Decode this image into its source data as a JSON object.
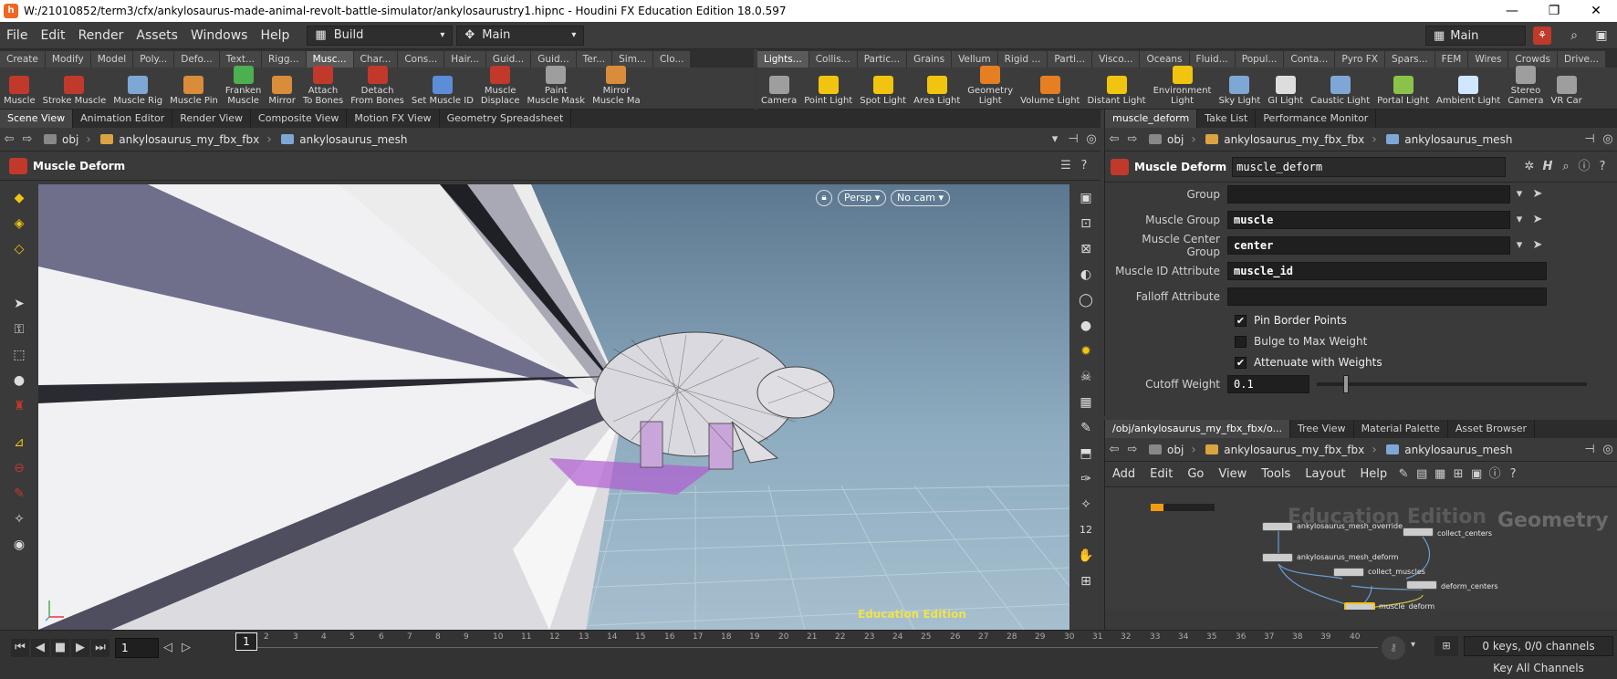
{
  "window": {
    "title": "W:/21010852/term3/cfx/ankylosaurus-made-animal-revolt-battle-simulator/ankylosaurustry1.hipnc - Houdini FX Education Edition 18.0.597",
    "controls": [
      "—",
      "❐",
      "✕"
    ]
  },
  "menubar": {
    "items": [
      "File",
      "Edit",
      "Render",
      "Assets",
      "Windows",
      "Help"
    ],
    "desktop": "Build",
    "network": "Main",
    "right_desktop": "Main"
  },
  "shelf_left": {
    "tabs": [
      "Create",
      "Modify",
      "Model",
      "Poly...",
      "Defo...",
      "Text...",
      "Rigg...",
      "Musc...",
      "Char...",
      "Cons...",
      "Hair...",
      "Guid...",
      "Guid...",
      "Ter...",
      "Sim...",
      "Clo..."
    ],
    "active_tab": 7,
    "tools": [
      {
        "label": "Muscle",
        "color": "#c0392b"
      },
      {
        "label": "Stroke Muscle",
        "color": "#c0392b"
      },
      {
        "label": "Muscle Rig",
        "color": "#7fa7d6"
      },
      {
        "label": "Muscle Pin",
        "color": "#d98c3a"
      },
      {
        "label": "Franken\nMuscle",
        "color": "#4caf50"
      },
      {
        "label": "Mirror",
        "color": "#d98c3a"
      },
      {
        "label": "Attach\nTo Bones",
        "color": "#c0392b"
      },
      {
        "label": "Detach\nFrom Bones",
        "color": "#c0392b"
      },
      {
        "label": "Set Muscle ID",
        "color": "#5b8ed6"
      },
      {
        "label": "Muscle\nDisplace",
        "color": "#c0392b"
      },
      {
        "label": "Paint\nMuscle Mask",
        "color": "#9e9e9e"
      },
      {
        "label": "Mirror\nMuscle Ma",
        "color": "#d98c3a"
      }
    ]
  },
  "shelf_right": {
    "tabs": [
      "Lights...",
      "Collis...",
      "Partic...",
      "Grains",
      "Vellum",
      "Rigid ...",
      "Parti...",
      "Visco...",
      "Oceans",
      "Fluid...",
      "Popul...",
      "Conta...",
      "Pyro FX",
      "Spars...",
      "FEM",
      "Wires",
      "Crowds",
      "Drive..."
    ],
    "active_tab": 0,
    "tools": [
      {
        "label": "Camera",
        "color": "#9e9e9e"
      },
      {
        "label": "Point Light",
        "color": "#f1c40f"
      },
      {
        "label": "Spot Light",
        "color": "#f1c40f"
      },
      {
        "label": "Area Light",
        "color": "#f1c40f"
      },
      {
        "label": "Geometry\nLight",
        "color": "#e67e22"
      },
      {
        "label": "Volume Light",
        "color": "#e67e22"
      },
      {
        "label": "Distant Light",
        "color": "#f1c40f"
      },
      {
        "label": "Environment\nLight",
        "color": "#f1c40f"
      },
      {
        "label": "Sky Light",
        "color": "#7fa7d6"
      },
      {
        "label": "GI Light",
        "color": "#dddddd"
      },
      {
        "label": "Caustic Light",
        "color": "#7fa7d6"
      },
      {
        "label": "Portal Light",
        "color": "#8bc34a"
      },
      {
        "label": "Ambient Light",
        "color": "#cfe8ff"
      },
      {
        "label": "Stereo\nCamera",
        "color": "#9e9e9e"
      },
      {
        "label": "VR Car",
        "color": "#9e9e9e"
      }
    ]
  },
  "viewer": {
    "tabs": [
      "Scene View",
      "Animation Editor",
      "Render View",
      "Composite View",
      "Motion FX View",
      "Geometry Spreadsheet"
    ],
    "active_tab": 0,
    "path": [
      "obj",
      "ankylosaurus_my_fbx_fbx",
      "ankylosaurus_mesh"
    ],
    "node_title": "Muscle Deform",
    "persp": "Persp ▾",
    "cam": "No cam ▾",
    "watermark": "Education Edition"
  },
  "params": {
    "tabs": [
      "muscle_deform",
      "Take List",
      "Performance Monitor"
    ],
    "active_tab": 0,
    "path": [
      "obj",
      "ankylosaurus_my_fbx_fbx",
      "ankylosaurus_mesh"
    ],
    "node_type": "Muscle Deform",
    "node_name": "muscle_deform",
    "fields": [
      {
        "label": "Group",
        "value": ""
      },
      {
        "label": "Muscle Group",
        "value": "muscle"
      },
      {
        "label": "Muscle Center Group",
        "value": "center"
      },
      {
        "label": "Muscle ID Attribute",
        "value": "muscle_id"
      },
      {
        "label": "Falloff Attribute",
        "value": ""
      }
    ],
    "checkboxes": [
      {
        "label": "Pin Border Points",
        "checked": true
      },
      {
        "label": "Bulge to Max Weight",
        "checked": false
      },
      {
        "label": "Attenuate with Weights",
        "checked": true
      }
    ],
    "cutoff_label": "Cutoff Weight",
    "cutoff_value": "0.1",
    "cutoff_fraction": 0.1
  },
  "network": {
    "tabs": [
      "/obj/ankylosaurus_my_fbx_fbx/o...",
      "Tree View",
      "Material Palette",
      "Asset Browser"
    ],
    "active_tab": 0,
    "path": [
      "obj",
      "ankylosaurus_my_fbx_fbx",
      "ankylosaurus_mesh"
    ],
    "menu": [
      "Add",
      "Edit",
      "Go",
      "View",
      "Tools",
      "Layout",
      "Help"
    ],
    "watermark": "Education Edition",
    "context_label": "Geometry",
    "nodes": [
      {
        "label": "ankylosaurus_mesh_override"
      },
      {
        "label": "collect_centers"
      },
      {
        "label": "ankylosaurus_mesh_deform"
      },
      {
        "label": "collect_muscles"
      },
      {
        "label": "deform_centers"
      },
      {
        "label": "muscle_deform"
      }
    ]
  },
  "timeline": {
    "current_frame": "1",
    "frame_marker": "1",
    "ticks": [
      "2",
      "3",
      "4",
      "5",
      "6",
      "7",
      "8",
      "9",
      "10",
      "11",
      "12",
      "13",
      "14",
      "15",
      "16",
      "17",
      "18",
      "19",
      "20",
      "21",
      "22",
      "23",
      "24",
      "25",
      "26",
      "27",
      "28",
      "29",
      "30",
      "31",
      "32",
      "33",
      "34",
      "35",
      "36",
      "37",
      "38",
      "39",
      "40"
    ],
    "keys_info": "0 keys, 0/0 channels",
    "key_all": "Key All Channels"
  }
}
